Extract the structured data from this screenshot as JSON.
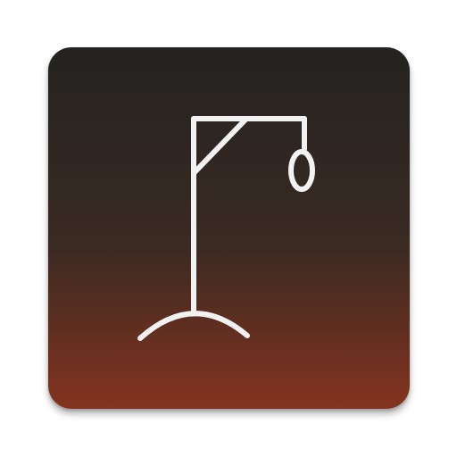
{
  "app_icon": {
    "icon": "hangman-gallows-icon",
    "colors": {
      "gradient_top": "#242321",
      "gradient_mid": "#3a2a22",
      "gradient_bottom": "#84331f",
      "stroke": "#f2f2f2"
    }
  }
}
